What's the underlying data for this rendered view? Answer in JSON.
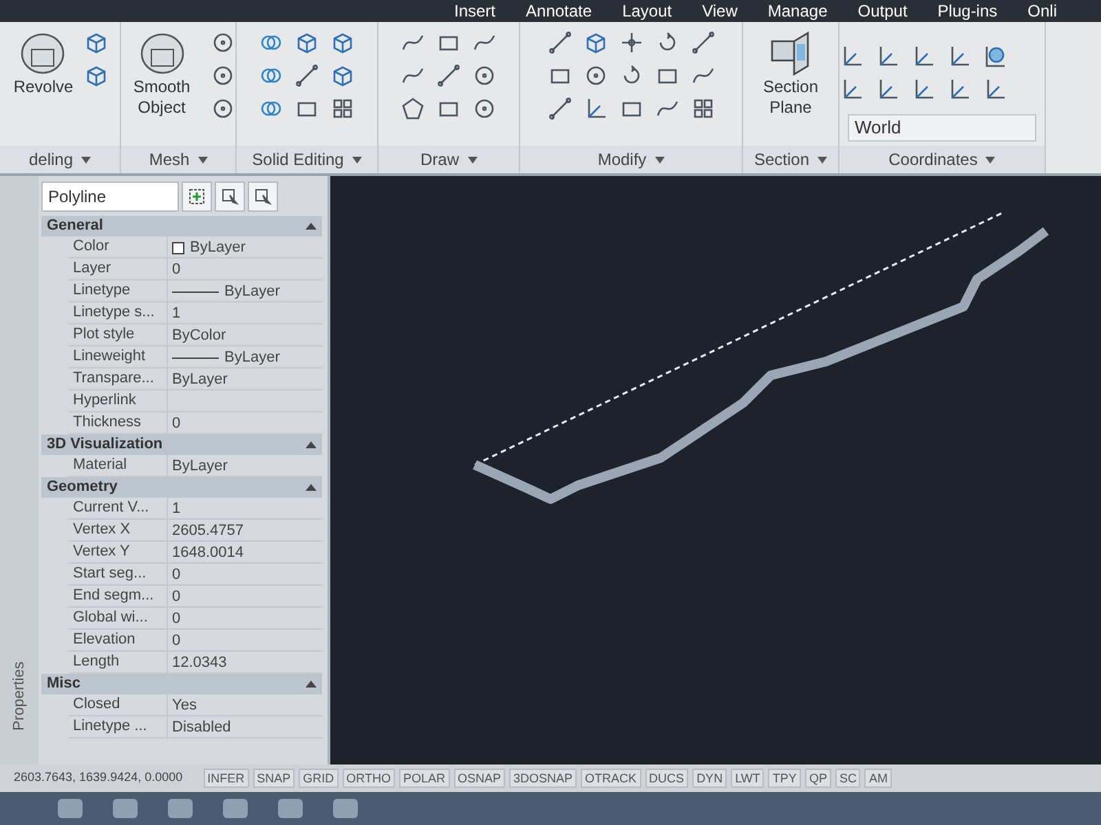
{
  "ribbon": {
    "tabs": [
      "Insert",
      "Annotate",
      "Layout",
      "View",
      "Manage",
      "Output",
      "Plug-ins",
      "Onli"
    ],
    "panels": [
      {
        "title": "deling",
        "large_button": "Revolve"
      },
      {
        "title": "Mesh",
        "large_button": "Smooth Object"
      },
      {
        "title": "Solid Editing"
      },
      {
        "title": "Draw"
      },
      {
        "title": "Modify"
      },
      {
        "title": "Section",
        "large_button": "Section Plane"
      },
      {
        "title": "Coordinates",
        "dropdown": "World"
      }
    ]
  },
  "properties": {
    "palette_title": "Properties",
    "object_type": "Polyline",
    "sections": [
      {
        "title": "General",
        "rows": [
          {
            "label": "Color",
            "value": "ByLayer",
            "kind": "color"
          },
          {
            "label": "Layer",
            "value": "0",
            "kind": "text"
          },
          {
            "label": "Linetype",
            "value": "ByLayer",
            "kind": "line"
          },
          {
            "label": "Linetype s...",
            "value": "1",
            "kind": "text"
          },
          {
            "label": "Plot style",
            "value": "ByColor",
            "kind": "text"
          },
          {
            "label": "Lineweight",
            "value": "ByLayer",
            "kind": "line"
          },
          {
            "label": "Transpare...",
            "value": "ByLayer",
            "kind": "text"
          },
          {
            "label": "Hyperlink",
            "kind": "text"
          },
          {
            "label": "Thickness",
            "value": "0",
            "kind": "text"
          }
        ]
      },
      {
        "title": "3D Visualization",
        "rows": [
          {
            "label": "Material",
            "value": "ByLayer",
            "kind": "text"
          }
        ]
      },
      {
        "title": "Geometry",
        "rows": [
          {
            "label": "Current V...",
            "value": "1",
            "kind": "text"
          },
          {
            "label": "Vertex X",
            "value": "2605.4757",
            "kind": "text"
          },
          {
            "label": "Vertex Y",
            "value": "1648.0014",
            "kind": "text"
          },
          {
            "label": "Start seg...",
            "value": "0",
            "kind": "text"
          },
          {
            "label": "End segm...",
            "value": "0",
            "kind": "text"
          },
          {
            "label": "Global wi...",
            "value": "0",
            "kind": "text"
          },
          {
            "label": "Elevation",
            "value": "0",
            "kind": "text"
          },
          {
            "label": "Length",
            "value": "12.0343",
            "kind": "text"
          }
        ]
      },
      {
        "title": "Misc",
        "rows": [
          {
            "label": "Closed",
            "value": "Yes",
            "kind": "text"
          },
          {
            "label": "Linetype ...",
            "value": "Disabled",
            "kind": "text"
          }
        ]
      }
    ]
  },
  "status_bar": {
    "coordinates": "2603.7643, 1639.9424, 0.0000",
    "toggles": [
      "INFER",
      "SNAP",
      "GRID",
      "ORTHO",
      "POLAR",
      "OSNAP",
      "3DOSNAP",
      "OTRACK",
      "DUCS",
      "DYN",
      "LWT",
      "TPY",
      "QP",
      "SC",
      "AM"
    ]
  }
}
